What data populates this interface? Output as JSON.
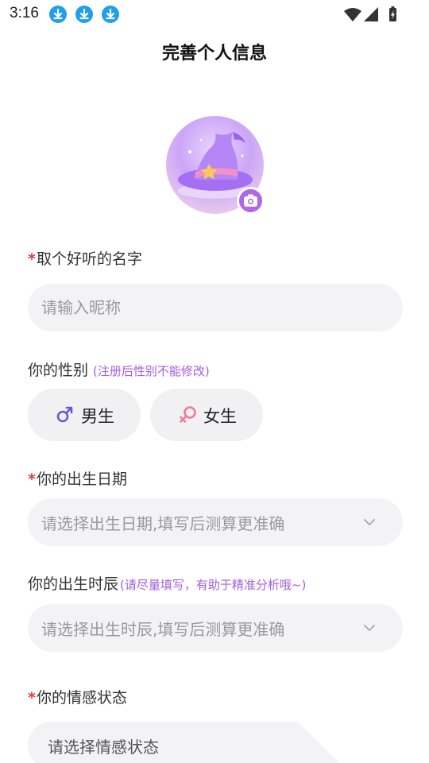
{
  "status_bar": {
    "time": "3:16",
    "notification_icons": [
      "download-icon",
      "download-icon",
      "download-icon"
    ],
    "right_icons": [
      "wifi-icon",
      "signal-icon",
      "battery-charging-icon"
    ]
  },
  "header": {
    "title": "完善个人信息"
  },
  "avatar": {
    "icon": "wizard-hat-icon",
    "camera_icon": "camera-icon"
  },
  "nickname": {
    "required_mark": "*",
    "label": "取个好听的名字",
    "placeholder": "请输入昵称",
    "value": ""
  },
  "gender": {
    "label": "你的性别",
    "hint": "(注册后性别不能修改)",
    "options": [
      {
        "label": "男生",
        "icon": "male-icon",
        "color": "#6a5acd"
      },
      {
        "label": "女生",
        "icon": "female-icon",
        "color": "#f07a9a"
      }
    ]
  },
  "birth_date": {
    "required_mark": "*",
    "label": "你的出生日期",
    "placeholder": "请选择出生日期,填写后测算更准确"
  },
  "birth_hour": {
    "label": "你的出生时辰",
    "hint": "(请尽量填写，有助于精准分析哦~)",
    "placeholder": "请选择出生时辰,填写后测算更准确"
  },
  "emotion": {
    "required_mark": "*",
    "label": "你的情感状态",
    "placeholder": "请选择情感状态"
  },
  "colors": {
    "accent": "#b068e8",
    "required": "#e03b3b",
    "hint": "#a45ee0",
    "input_bg": "#f3f3f5"
  }
}
